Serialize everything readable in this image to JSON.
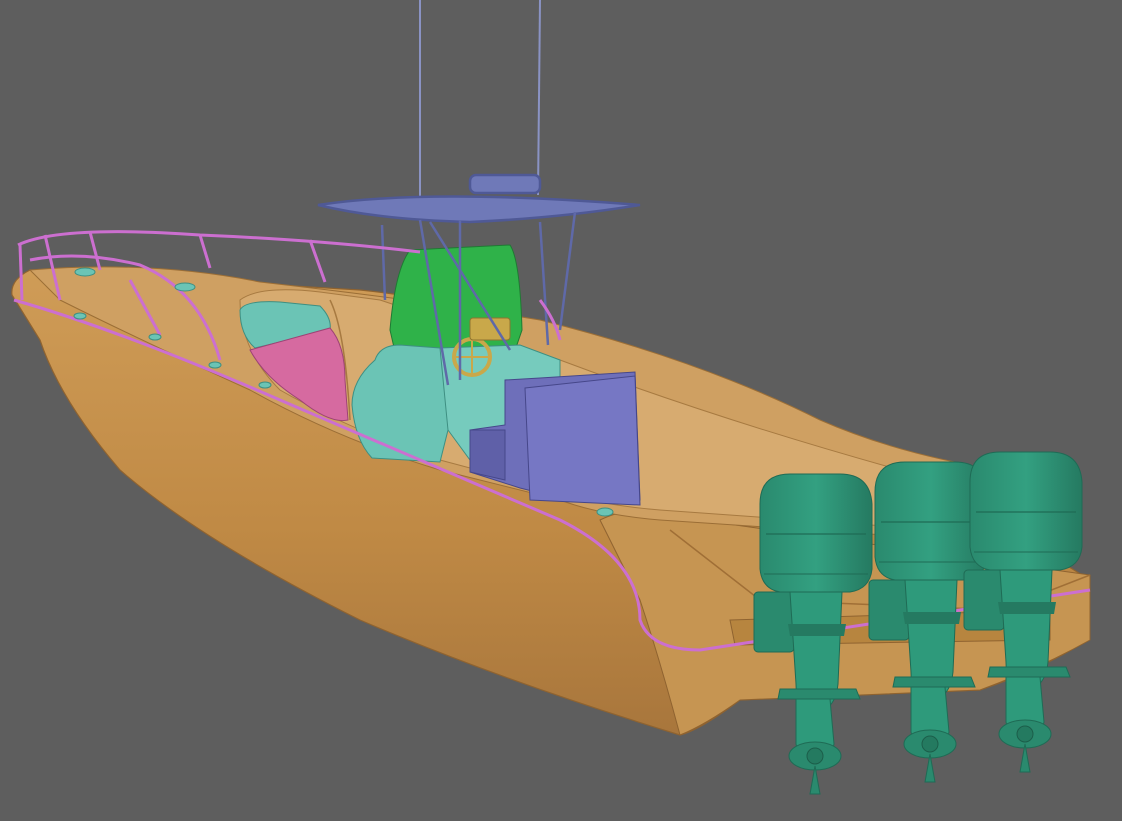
{
  "scene": {
    "subject": "boat-3d-model",
    "colors": {
      "background": "#5e5e5e",
      "hull": "#c4904a",
      "hull_shadow": "#a5733a",
      "deck": "#cfa062",
      "rail": "#cc6fd0",
      "tower": "#6f79b8",
      "console": "#2fb249",
      "seat": "#6bc4b5",
      "cushion": "#d66aa0",
      "box": "#6e6fba",
      "engine": "#2f9477",
      "wheel": "#c9a84a"
    },
    "engines": {
      "count": 3
    }
  }
}
